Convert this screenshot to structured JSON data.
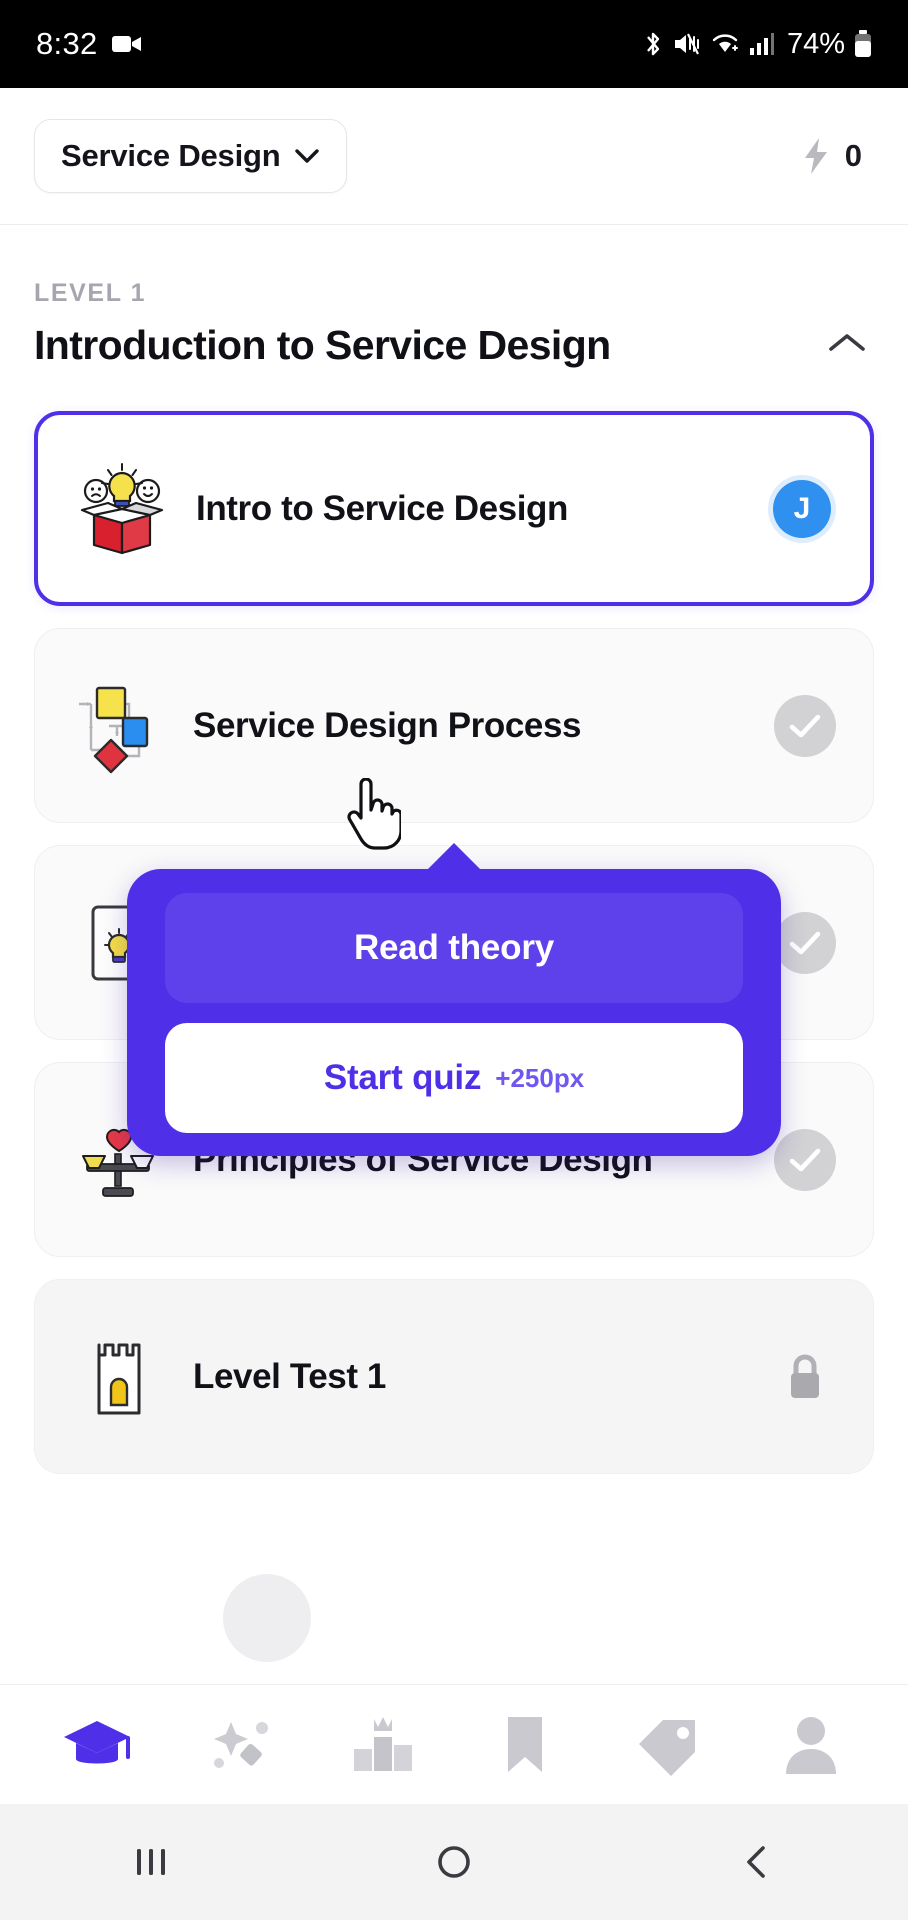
{
  "status_bar": {
    "time": "8:32",
    "battery_percent": "74%",
    "icons": [
      "video-camera-icon",
      "bluetooth-icon",
      "mute-icon",
      "wifi-icon",
      "cellular-signal-icon",
      "battery-icon"
    ]
  },
  "app_bar": {
    "course_name": "Service Design",
    "course_chevron": "chevron-down-icon",
    "energy_icon": "lightning-bolt-icon",
    "energy_count": "0"
  },
  "section": {
    "level_label": "LEVEL 1",
    "title": "Introduction to Service Design",
    "collapse_icon": "chevron-up-icon"
  },
  "lessons": [
    {
      "title": "Intro to Service Design",
      "icon": "idea-box-icon",
      "state": "active",
      "badge": "J",
      "badge_type": "avatar"
    },
    {
      "title": "Service Design Process",
      "icon": "flowchart-icon",
      "state": "completed",
      "badge": "check-circle-icon",
      "badge_type": "check"
    },
    {
      "title": "",
      "icon": "flashcard-idea-icon",
      "state": "completed",
      "badge": "check-circle-icon",
      "badge_type": "check"
    },
    {
      "title": "Principles of Service Design",
      "icon": "balance-scale-heart-icon",
      "state": "completed",
      "badge": "check-circle-icon",
      "badge_type": "check"
    },
    {
      "title": "Level Test 1",
      "icon": "castle-tower-icon",
      "state": "locked",
      "badge": "lock-icon",
      "badge_type": "lock"
    }
  ],
  "popup": {
    "read_theory_label": "Read theory",
    "start_quiz_label": "Start quiz",
    "start_quiz_reward": "+250px",
    "cursor": "hand-pointer-cursor"
  },
  "bottom_nav": [
    {
      "name": "learn",
      "icon": "graduation-cap-icon",
      "active": true
    },
    {
      "name": "practice",
      "icon": "magic-wand-icon",
      "active": false
    },
    {
      "name": "leaderboard",
      "icon": "podium-icon",
      "active": false
    },
    {
      "name": "bookmarks",
      "icon": "bookmark-icon",
      "active": false
    },
    {
      "name": "tags",
      "icon": "tag-icon",
      "active": false
    },
    {
      "name": "profile",
      "icon": "person-icon",
      "active": false
    }
  ],
  "system_nav": [
    {
      "name": "recents",
      "icon": "recents-icon"
    },
    {
      "name": "home",
      "icon": "home-circle-icon"
    },
    {
      "name": "back",
      "icon": "back-chevron-icon"
    }
  ],
  "colors": {
    "accent": "#4f2fe8",
    "accent_light": "#5e41ea",
    "avatar_blue": "#2f90f0",
    "check_gray": "#d2d2d4",
    "card_bg": "#fafafa",
    "locked_bg": "#f5f5f6"
  }
}
